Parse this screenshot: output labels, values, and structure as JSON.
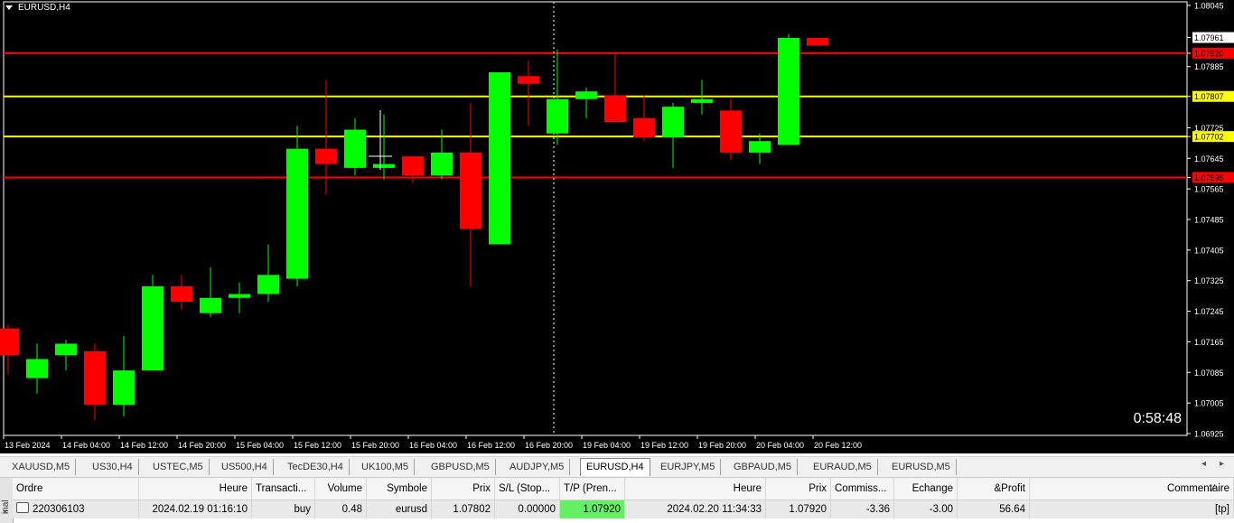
{
  "chart": {
    "symbol_label": "EURUSD,H4",
    "countdown": "0:58:48",
    "price_axis": {
      "min": 1.06925,
      "max": 1.08045,
      "labels": [
        "1.08045",
        "1.07961",
        "1.07920",
        "1.07885",
        "1.07807",
        "1.07725",
        "1.07702",
        "1.07645",
        "1.07595",
        "1.07565",
        "1.07485",
        "1.07405",
        "1.07325",
        "1.07245",
        "1.07165",
        "1.07085",
        "1.07005",
        "1.06925"
      ]
    },
    "time_axis": {
      "labels": [
        "13 Feb 2024",
        "14 Feb 04:00",
        "14 Feb 12:00",
        "14 Feb 20:00",
        "15 Feb 04:00",
        "15 Feb 12:00",
        "15 Feb 20:00",
        "16 Feb 04:00",
        "16 Feb 12:00",
        "16 Feb 20:00",
        "19 Feb 04:00",
        "19 Feb 12:00",
        "19 Feb 20:00",
        "20 Feb 04:00",
        "20 Feb 12:00"
      ]
    },
    "levels": [
      {
        "price": 1.0792,
        "color": "#ff0000",
        "label": "1.07920"
      },
      {
        "price": 1.07807,
        "color": "#ffff00",
        "label": "1.07807"
      },
      {
        "price": 1.07702,
        "color": "#ffff00",
        "label": "1.07702"
      },
      {
        "price": 1.07595,
        "color": "#ff0000",
        "label": "1.07595"
      }
    ],
    "current_price": {
      "value": 1.07961,
      "label": "1.07961"
    },
    "colors": {
      "bull": "#00ff00",
      "bear": "#ff0000",
      "background": "#000000",
      "text": "#ffffff"
    }
  },
  "chart_data": {
    "type": "candlestick",
    "series": [
      {
        "name": "EURUSD,H4",
        "ohlc": [
          [
            1.072,
            1.0721,
            1.0708,
            1.0713
          ],
          [
            1.0707,
            1.0716,
            1.0703,
            1.0712
          ],
          [
            1.0713,
            1.0717,
            1.0709,
            1.0716
          ],
          [
            1.0714,
            1.0716,
            1.0696,
            1.07
          ],
          [
            1.07,
            1.0718,
            1.0697,
            1.0709
          ],
          [
            1.0709,
            1.0734,
            1.0709,
            1.0731
          ],
          [
            1.0731,
            1.0734,
            1.0725,
            1.0727
          ],
          [
            1.0724,
            1.0736,
            1.0723,
            1.0728
          ],
          [
            1.0728,
            1.0732,
            1.0724,
            1.0729
          ],
          [
            1.0729,
            1.0742,
            1.0727,
            1.0734
          ],
          [
            1.0733,
            1.0773,
            1.0731,
            1.0767
          ],
          [
            1.0767,
            1.0785,
            1.0755,
            1.0763
          ],
          [
            1.0762,
            1.0775,
            1.076,
            1.0772
          ],
          [
            1.0762,
            1.0776,
            1.0759,
            1.0763
          ],
          [
            1.0765,
            1.0765,
            1.0758,
            1.076
          ],
          [
            1.076,
            1.0772,
            1.0759,
            1.0766
          ],
          [
            1.0766,
            1.0779,
            1.0731,
            1.0746
          ],
          [
            1.0742,
            1.0787,
            1.0742,
            1.0787
          ],
          [
            1.0786,
            1.079,
            1.0773,
            1.0784
          ],
          [
            1.0771,
            1.0793,
            1.0768,
            1.078
          ],
          [
            1.078,
            1.0783,
            1.0775,
            1.0782
          ],
          [
            1.0781,
            1.0792,
            1.0775,
            1.0774
          ],
          [
            1.0775,
            1.0781,
            1.0769,
            1.077
          ],
          [
            1.077,
            1.0779,
            1.0762,
            1.0778
          ],
          [
            1.0779,
            1.0785,
            1.0776,
            1.078
          ],
          [
            1.0777,
            1.078,
            1.0764,
            1.0766
          ],
          [
            1.0766,
            1.0771,
            1.0763,
            1.0769
          ],
          [
            1.0768,
            1.0797,
            1.0768,
            1.0796
          ],
          [
            1.0796,
            1.0796,
            1.0794,
            1.0794
          ]
        ]
      }
    ],
    "ylim": [
      1.06925,
      1.08045
    ]
  },
  "tabs": {
    "items": [
      "XAUUSD,M5",
      "US30,H4",
      "USTEC,M5",
      "US500,H4",
      "TecDE30,H4",
      "UK100,M5",
      "GBPUSD,M5",
      "AUDJPY,M5",
      "EURUSD,H4",
      "EURJPY,M5",
      "GBPAUD,M5",
      "EURAUD,M5",
      "EURUSD,M5"
    ],
    "active": "EURUSD,H4",
    "scroll_left": "◂",
    "scroll_right": "▸"
  },
  "terminal": {
    "side_label": "inal",
    "close_glyph": "×",
    "headers": [
      "Ordre",
      "Heure",
      "Transacti...",
      "Volume",
      "Symbole",
      "Prix",
      "S/L (Stop...",
      "T/P (Pren...",
      "Heure",
      "Prix",
      "Commiss...",
      "Echange",
      "&Profit",
      "Commentaire"
    ],
    "sort_arrow": "∕",
    "row": [
      "220306103",
      "2024.02.19 01:16:10",
      "buy",
      "0.48",
      "eurusd",
      "1.07802",
      "0.00000",
      "1.07920",
      "2024.02.20 11:34:33",
      "1.07920",
      "-3.36",
      "-3.00",
      "56.64",
      "[tp]"
    ]
  }
}
